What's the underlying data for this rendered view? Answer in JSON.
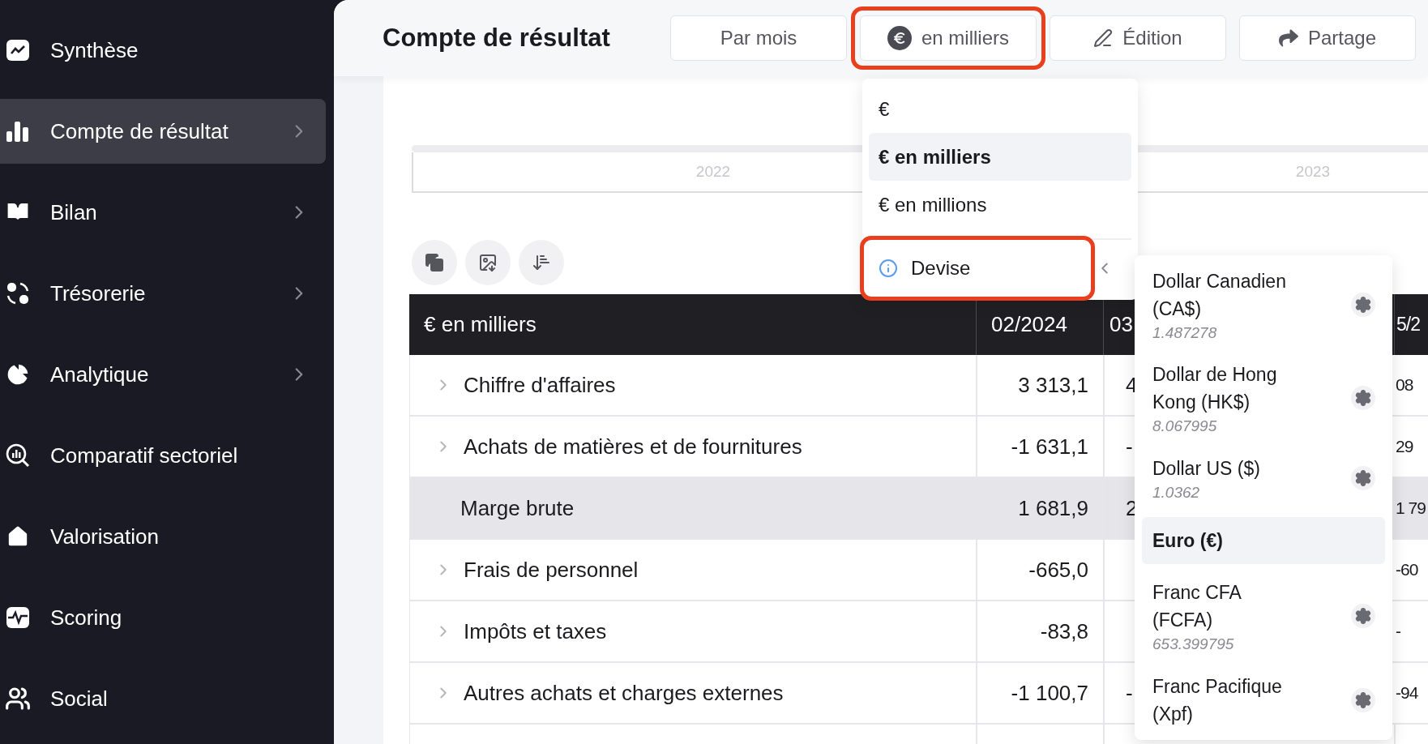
{
  "sidebar": {
    "items": [
      {
        "label": "Synthèse",
        "selected": false,
        "expandable": false
      },
      {
        "label": "Compte de résultat",
        "selected": true,
        "expandable": true
      },
      {
        "label": "Bilan",
        "selected": false,
        "expandable": true
      },
      {
        "label": "Trésorerie",
        "selected": false,
        "expandable": true
      },
      {
        "label": "Analytique",
        "selected": false,
        "expandable": true
      },
      {
        "label": "Comparatif sectoriel",
        "selected": false,
        "expandable": false
      },
      {
        "label": "Valorisation",
        "selected": false,
        "expandable": false
      },
      {
        "label": "Scoring",
        "selected": false,
        "expandable": false
      },
      {
        "label": "Social",
        "selected": false,
        "expandable": false
      }
    ]
  },
  "header": {
    "title": "Compte de résultat",
    "buttons": [
      {
        "label": "Par mois",
        "highlighted": false
      },
      {
        "label": "en milliers",
        "highlighted": true
      },
      {
        "label": "Édition",
        "highlighted": false
      },
      {
        "label": "Partage",
        "highlighted": false
      }
    ]
  },
  "timeline": {
    "labels": [
      "2022",
      "2023"
    ]
  },
  "table": {
    "columns": [
      "€ en milliers",
      "02/2024",
      "03",
      "5/2"
    ],
    "rows": [
      {
        "expandable": true,
        "subtotal": false,
        "cells": [
          "Chiffre d'affaires",
          "3 313,1",
          "4",
          "08"
        ]
      },
      {
        "expandable": true,
        "subtotal": false,
        "cells": [
          "Achats de matières et de fournitures",
          "-1 631,1",
          "-",
          "29"
        ]
      },
      {
        "expandable": false,
        "subtotal": true,
        "cells": [
          "Marge brute",
          "1 681,9",
          "2",
          "1 79"
        ]
      },
      {
        "expandable": true,
        "subtotal": false,
        "cells": [
          "Frais de personnel",
          "-665,0",
          "",
          "-60"
        ]
      },
      {
        "expandable": true,
        "subtotal": false,
        "cells": [
          "Impôts et taxes",
          "-83,8",
          "",
          "-"
        ]
      },
      {
        "expandable": true,
        "subtotal": false,
        "cells": [
          "Autres achats et charges externes",
          "-1 100,7",
          "-",
          "-94"
        ]
      }
    ]
  },
  "unit_menu": {
    "items": [
      {
        "label": "€",
        "selected": false
      },
      {
        "label": "€ en milliers",
        "selected": true
      },
      {
        "label": "€ en millions",
        "selected": false
      }
    ],
    "currency_item": {
      "label": "Devise",
      "highlighted": true
    }
  },
  "currency_menu": {
    "items": [
      {
        "name": "Dollar Canadien (CA$)",
        "rate": "1.487278",
        "selected": false
      },
      {
        "name": "Dollar de Hong Kong (HK$)",
        "rate": "8.067995",
        "selected": false
      },
      {
        "name": "Dollar US ($)",
        "rate": "1.0362",
        "selected": false
      },
      {
        "name": "Euro (€)",
        "selected": true
      },
      {
        "name": "Franc CFA (FCFA)",
        "rate": "653.399795",
        "selected": false
      },
      {
        "name": "Franc Pacifique (Xpf)",
        "selected": false
      }
    ]
  }
}
